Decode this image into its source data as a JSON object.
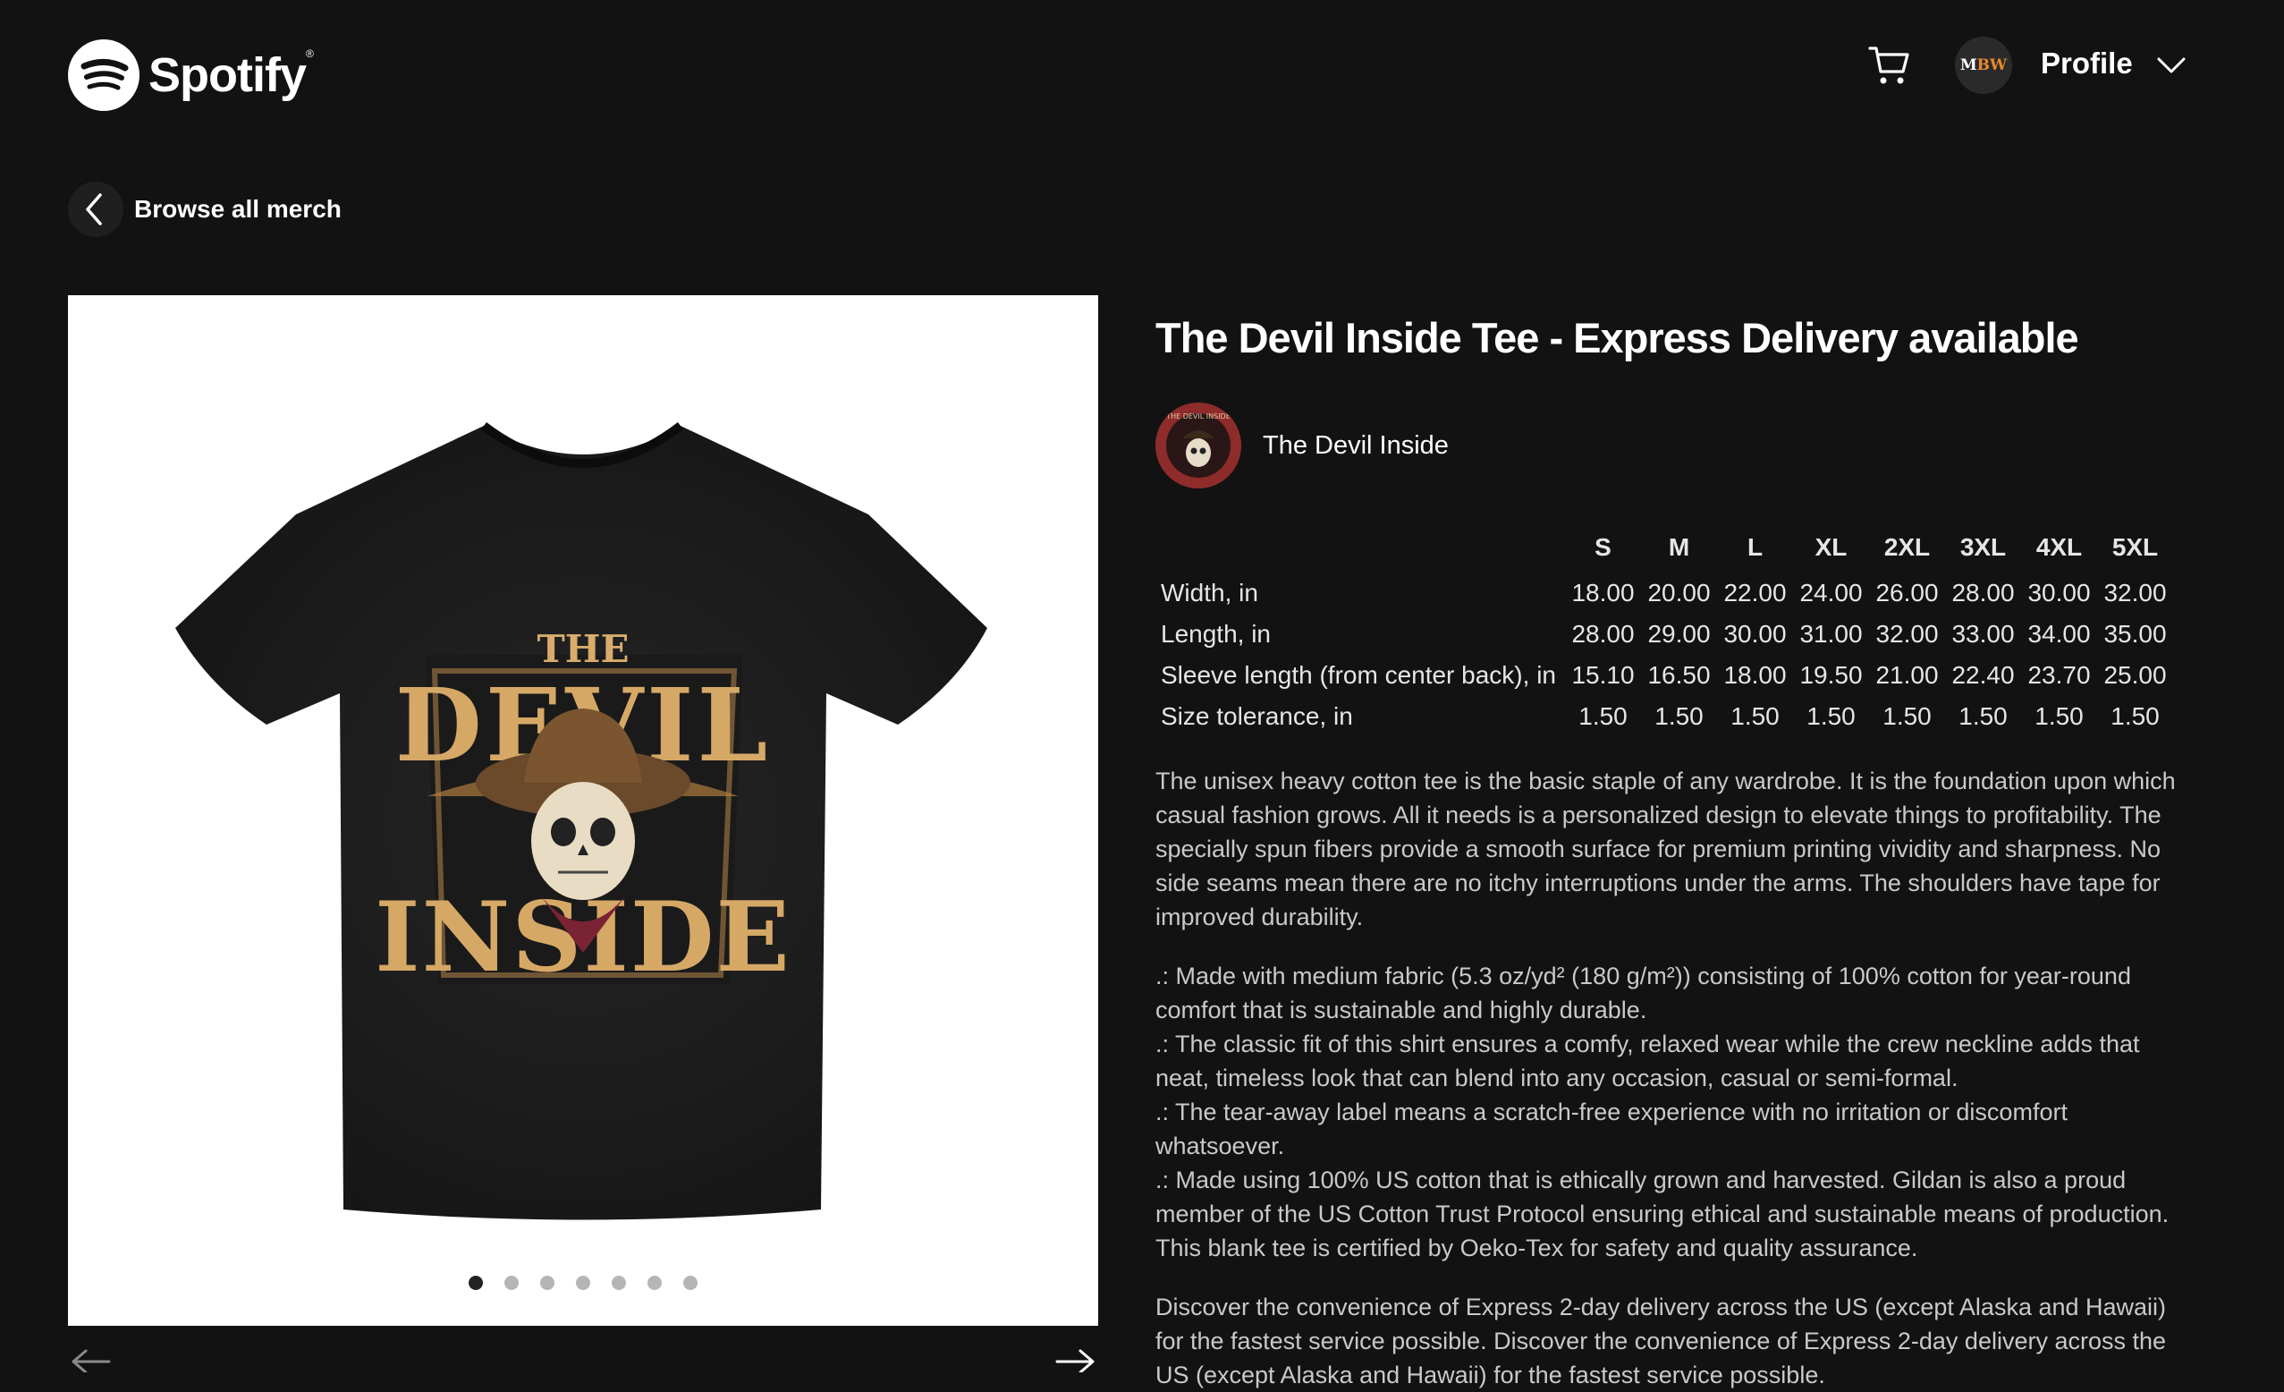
{
  "header": {
    "logo_text": "Spotify",
    "logo_tm": "®",
    "avatar_initials_a": "M",
    "avatar_initials_b": "BW",
    "profile_label": "Profile"
  },
  "back_link": {
    "label": "Browse all merch"
  },
  "product": {
    "title": "The Devil Inside Tee - Express Delivery available",
    "artist_name": "The Devil Inside",
    "image_dots": 7,
    "active_dot": 1,
    "shirt_print": {
      "top": "THE",
      "middle": "DEVIL",
      "bottom": "INSIDE"
    },
    "artist_badge_text": "THE DEVIL INSIDE"
  },
  "size_chart": {
    "columns": [
      "S",
      "M",
      "L",
      "XL",
      "2XL",
      "3XL",
      "4XL",
      "5XL"
    ],
    "rows": [
      {
        "label": "Width, in",
        "values": [
          "18.00",
          "20.00",
          "22.00",
          "24.00",
          "26.00",
          "28.00",
          "30.00",
          "32.00"
        ]
      },
      {
        "label": "Length, in",
        "values": [
          "28.00",
          "29.00",
          "30.00",
          "31.00",
          "32.00",
          "33.00",
          "34.00",
          "35.00"
        ]
      },
      {
        "label": "Sleeve length (from center back), in",
        "values": [
          "15.10",
          "16.50",
          "18.00",
          "19.50",
          "21.00",
          "22.40",
          "23.70",
          "25.00"
        ]
      },
      {
        "label": "Size tolerance, in",
        "values": [
          "1.50",
          "1.50",
          "1.50",
          "1.50",
          "1.50",
          "1.50",
          "1.50",
          "1.50"
        ]
      }
    ]
  },
  "description": {
    "intro": "The unisex heavy cotton tee is the basic staple of any wardrobe. It is the foundation upon which casual fashion grows. All it needs is a personalized design to elevate things to profitability. The specially spun fibers provide a smooth surface for premium printing vividity and sharpness. No side seams mean there are no itchy interruptions under the arms. The shoulders have tape for improved durability.",
    "bullets": [
      ".: Made with medium fabric (5.3 oz/yd² (180 g/m²)) consisting of 100% cotton for year-round comfort that is sustainable and highly durable.",
      ".: The classic fit of this shirt ensures a comfy, relaxed wear while the crew neckline adds that neat, timeless look that can blend into any occasion, casual or semi-formal.",
      ".: The tear-away label means a scratch-free experience with no irritation or discomfort whatsoever.",
      ".: Made using 100% US cotton that is ethically grown and harvested. Gildan is also a proud member of the US Cotton Trust Protocol ensuring ethical and sustainable means of production. This blank tee is certified by Oeko-Tex for safety and quality assurance."
    ],
    "delivery": "Discover the convenience of Express 2-day delivery across the US (except Alaska and Hawaii) for the fastest service possible. Discover the convenience of Express 2-day delivery across the US (except Alaska and Hawaii) for the fastest service possible."
  }
}
